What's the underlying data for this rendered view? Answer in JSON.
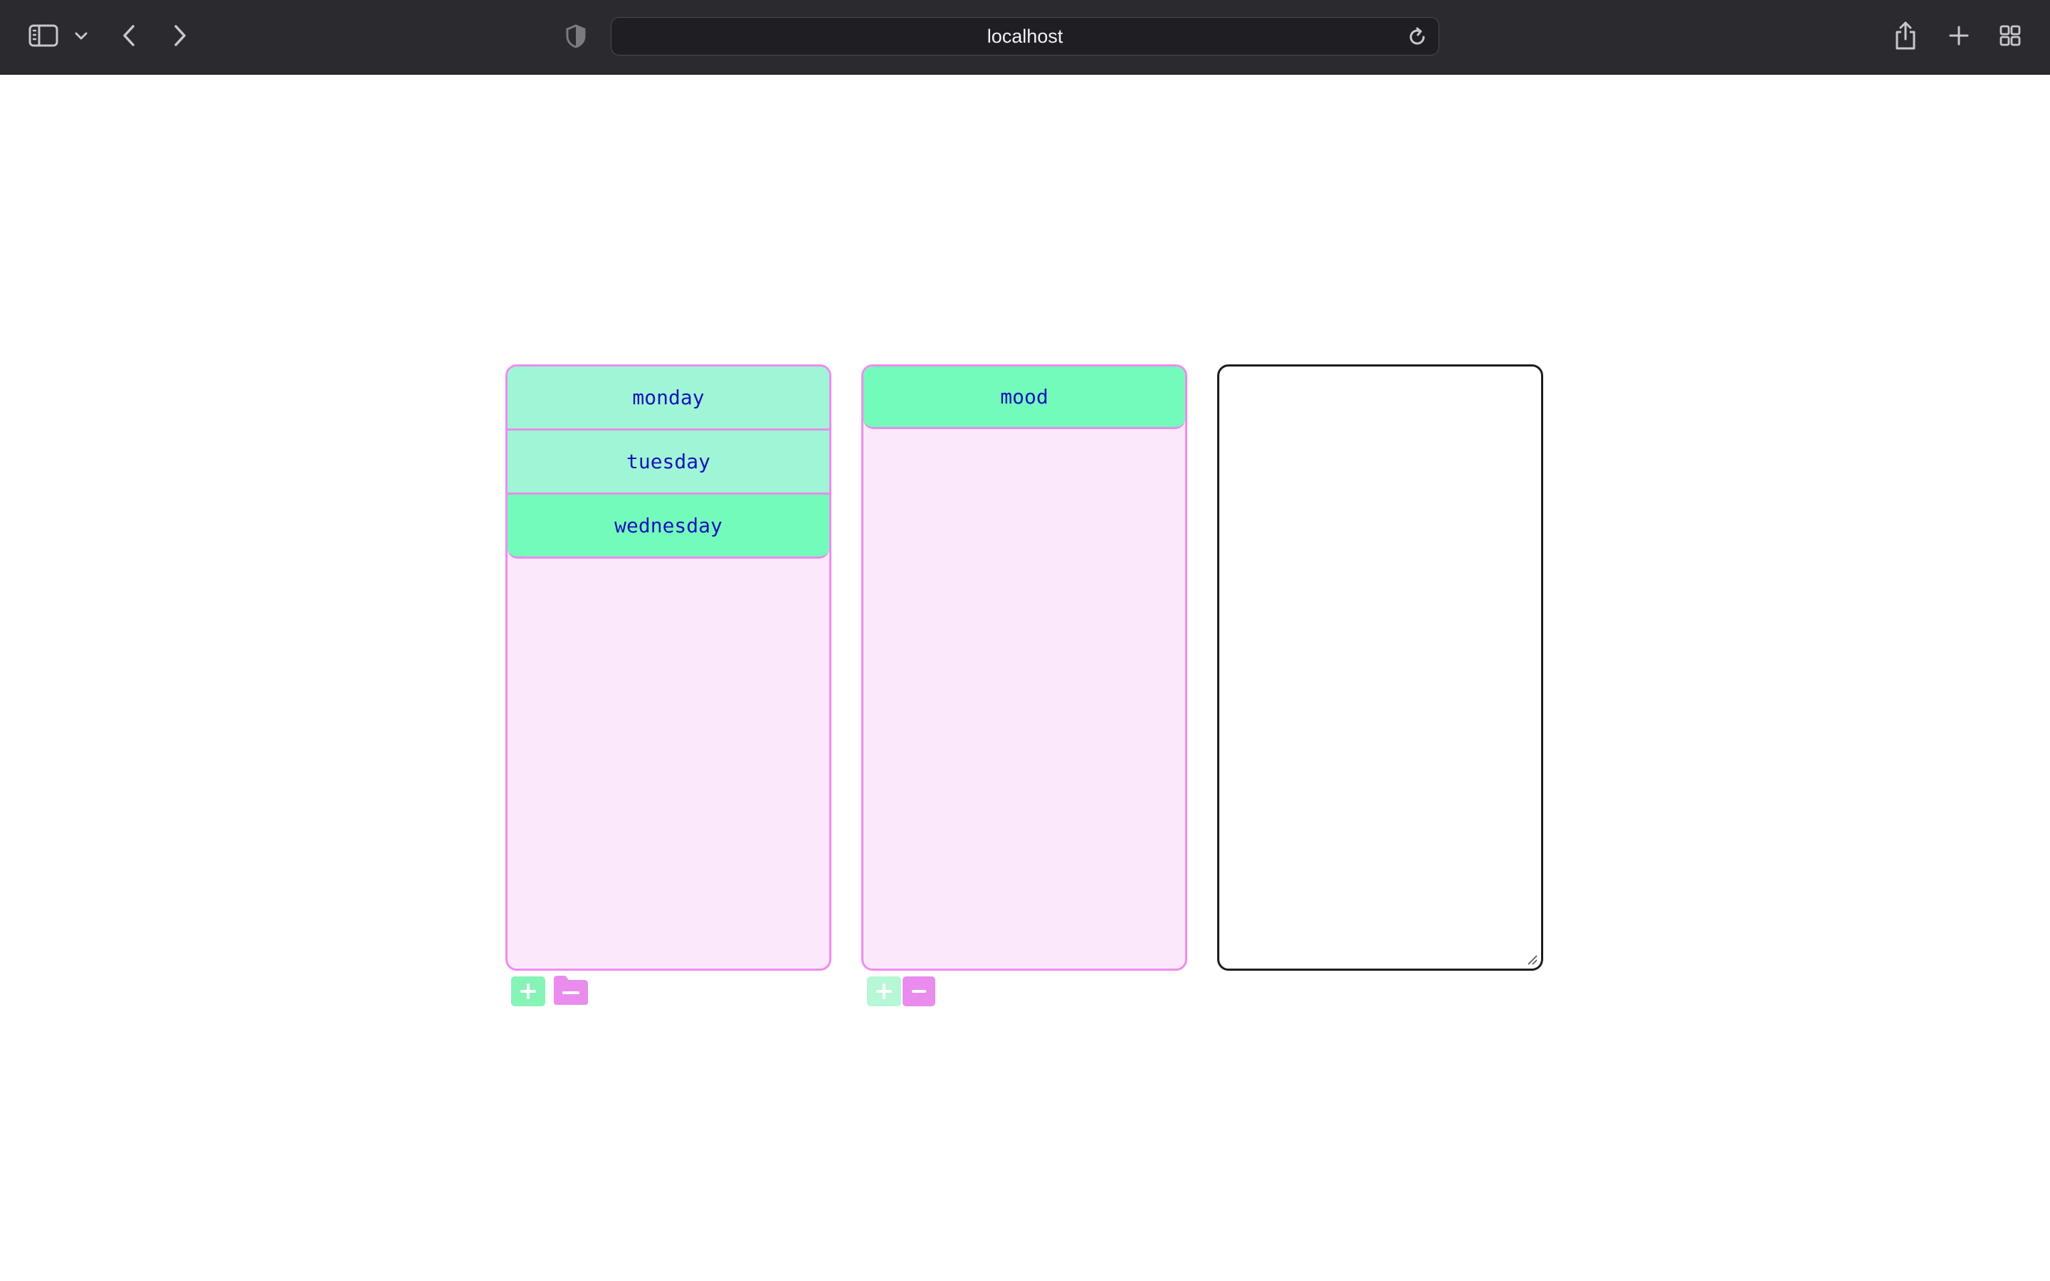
{
  "browser": {
    "url": "localhost",
    "icons": {
      "sidebar": "sidebar-icon",
      "sidebar_menu": "chevron-down-icon",
      "back": "back-icon",
      "forward": "forward-icon",
      "privacy": "shield-icon",
      "reload": "reload-icon",
      "share": "share-icon",
      "new_tab": "plus-icon",
      "tab_overview": "grid-icon"
    }
  },
  "columns": {
    "days": {
      "items": [
        {
          "label": "monday"
        },
        {
          "label": "tuesday"
        },
        {
          "label": "wednesday"
        }
      ],
      "selected_index": 2
    },
    "entries": {
      "items": [
        {
          "label": "mood"
        }
      ]
    },
    "editor": {
      "value": ""
    }
  },
  "colors": {
    "item_bg": "#9ef6d6",
    "item_selected_bg": "#73fbbb",
    "item_text": "#1b12b8",
    "list_bg": "#fbe8fa",
    "list_border": "#ee8cf0",
    "add_button": "#86f4b6",
    "remove_button": "#ea8cee"
  }
}
